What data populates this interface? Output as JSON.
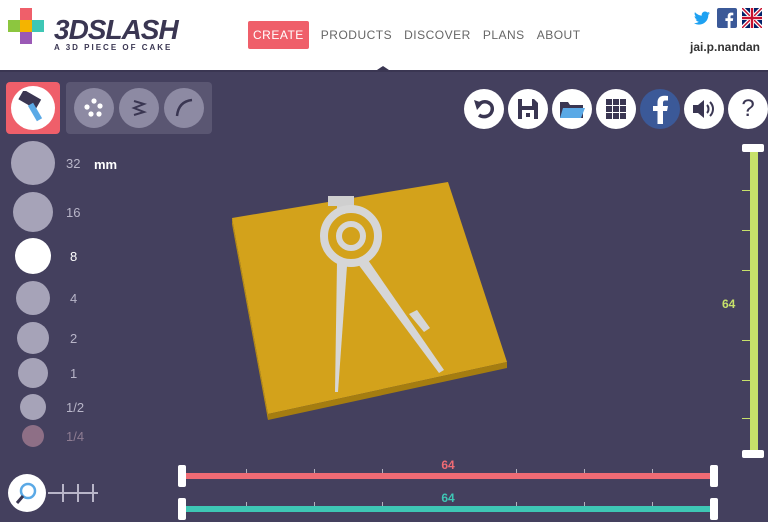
{
  "header": {
    "brand": "3DSLASH",
    "tagline": "A 3D PIECE OF CAKE",
    "nav": [
      {
        "label": "CREATE",
        "active": true
      },
      {
        "label": "PRODUCTS",
        "active": false
      },
      {
        "label": "DISCOVER",
        "active": false
      },
      {
        "label": "PLANS",
        "active": false
      },
      {
        "label": "ABOUT",
        "active": false
      }
    ],
    "social_icons": [
      "twitter-icon",
      "facebook-icon",
      "uk-flag-icon"
    ],
    "username": "jai.p.nandan"
  },
  "tools": {
    "active_tool": "hammer-icon",
    "group": [
      "dots-icon",
      "zigzag-icon",
      "curve-icon"
    ]
  },
  "sizes": {
    "unit": "mm",
    "items": [
      {
        "label": "32",
        "selected": false,
        "dim": false
      },
      {
        "label": "16",
        "selected": false,
        "dim": false
      },
      {
        "label": "8",
        "selected": true,
        "dim": false
      },
      {
        "label": "4",
        "selected": false,
        "dim": false
      },
      {
        "label": "2",
        "selected": false,
        "dim": false
      },
      {
        "label": "1",
        "selected": false,
        "dim": false
      },
      {
        "label": "1/2",
        "selected": false,
        "dim": false
      },
      {
        "label": "1/4",
        "selected": false,
        "dim": true
      }
    ]
  },
  "right_toolbar": [
    "undo-icon",
    "save-icon",
    "folder-icon",
    "grid-icon",
    "facebook-icon",
    "sound-icon",
    "help-icon"
  ],
  "help_label": "?",
  "sliders": {
    "vertical": {
      "value": "64",
      "color": "#c7e16a"
    },
    "horizontal_top": {
      "value": "64",
      "color": "#ef6b74"
    },
    "horizontal_bottom": {
      "value": "64",
      "color": "#3ec7b5"
    }
  },
  "colors": {
    "accent": "#ef5f6a",
    "background": "#44405e",
    "block": "#d3a21b"
  }
}
